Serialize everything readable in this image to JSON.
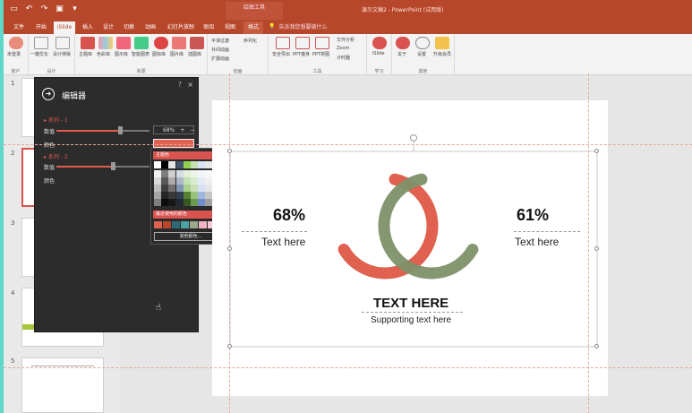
{
  "app": {
    "qat_icons": [
      "save-icon",
      "undo-icon",
      "redo-icon",
      "presentation-icon",
      "more-icon"
    ],
    "context_tab_group": "绘图工具",
    "doc_title": "演示文稿2 - PowerPoint (试用版)"
  },
  "tabs": [
    {
      "label": "文件"
    },
    {
      "label": "开始"
    },
    {
      "label": "iSlide"
    },
    {
      "label": "插入"
    },
    {
      "label": "设计"
    },
    {
      "label": "切换"
    },
    {
      "label": "动画"
    },
    {
      "label": "幻灯片放映"
    },
    {
      "label": "审阅"
    },
    {
      "label": "视图"
    },
    {
      "label": "格式"
    }
  ],
  "tell_me": "告诉我您想要做什么",
  "ribbon": {
    "account_label": "未登录",
    "account_group": "账户",
    "design_btns": [
      "一键优化",
      "设计排版"
    ],
    "design_group": "设计",
    "resource_btns": [
      "主题库",
      "色彩库",
      "图示库",
      "智能图表",
      "图标库",
      "图片库",
      "插图库"
    ],
    "resource_group": "资源",
    "anim_btns": [
      "平滑过渡",
      "补间动画",
      "扩展动画",
      "序列化"
    ],
    "anim_group": "动画",
    "tool_btns": [
      "安全导出",
      "PPT瘦身",
      "PPT拼图"
    ],
    "tool_small": [
      "文件分析",
      "Zoom",
      "计时器"
    ],
    "tool_group": "工具",
    "learn_btns": [
      "iSlide"
    ],
    "learn_group": "学习",
    "other_btns": [
      "关于",
      "设置",
      "升级会员"
    ],
    "other_group": "其他"
  },
  "thumbnails": [
    {
      "num": "1"
    },
    {
      "num": "2"
    },
    {
      "num": "3"
    },
    {
      "num": "4"
    },
    {
      "num": "5"
    }
  ],
  "editor_panel": {
    "title": "编辑器",
    "help": "?",
    "close": "×",
    "series1_label": "▸ 系列 - 1",
    "series1_value_label": "数值",
    "series1_color_label": "颜色",
    "series1_value": "68%",
    "series1_slider": 0.68,
    "series2_label": "▸ 系列 - 2",
    "series2_value_label": "数值",
    "series2_color_label": "颜色",
    "series2_slider": 0.61,
    "value_plus": "+",
    "value_minus": "−"
  },
  "color_picker": {
    "theme_header": "主题色",
    "recent_header": "最近使用的颜色",
    "more_colors": "其他颜色...",
    "recent_colors": [
      "#e0614f",
      "#b7472a",
      "#2d6a78",
      "#4aa3a0",
      "#9aa98c",
      "#f2b3c4",
      "#f7c9d4"
    ]
  },
  "slide": {
    "left_pct": "68%",
    "left_text": "Text here",
    "right_pct": "61%",
    "right_text": "Text here",
    "title": "TEXT HERE",
    "subtitle": "Supporting text here",
    "colors": {
      "red": "#e0614f",
      "green": "#7e9169"
    }
  }
}
